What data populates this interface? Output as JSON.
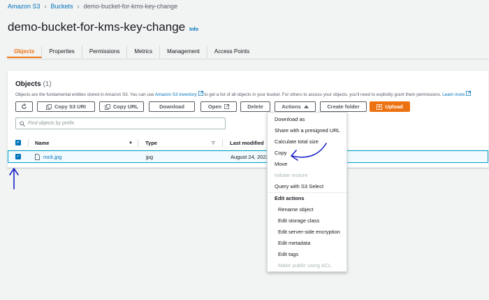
{
  "breadcrumb": {
    "root": "Amazon S3",
    "buckets": "Buckets",
    "current": "demo-bucket-for-kms-key-change"
  },
  "page": {
    "title": "demo-bucket-for-kms-key-change",
    "info": "Info"
  },
  "tabs": [
    "Objects",
    "Properties",
    "Permissions",
    "Metrics",
    "Management",
    "Access Points"
  ],
  "objects": {
    "title": "Objects",
    "count": "(1)",
    "description_pre": "Objects are the fundamental entities stored in Amazon S3. You can use ",
    "inventory_link": "Amazon S3 inventory",
    "description_post": " to get a list of all objects in your bucket. For others to access your objects, you'll need to explicitly grant them permissions. ",
    "learn_more": "Learn more"
  },
  "toolbar": {
    "copy_s3_uri": "Copy S3 URI",
    "copy_url": "Copy URL",
    "download": "Download",
    "open": "Open",
    "delete": "Delete",
    "actions": "Actions",
    "create_folder": "Create folder",
    "upload": "Upload"
  },
  "search": {
    "placeholder": "Find objects by prefix"
  },
  "table": {
    "columns": [
      "Name",
      "Type",
      "Last modified"
    ],
    "rows": [
      {
        "name": "rock.jpg",
        "type": "jpg",
        "last_modified": "August 24, 2022"
      }
    ]
  },
  "actions_menu": {
    "items": [
      {
        "label": "Download as",
        "disabled": false
      },
      {
        "label": "Share with a presigned URL",
        "disabled": false
      },
      {
        "label": "Calculate total size",
        "disabled": false
      },
      {
        "label": "Copy",
        "disabled": false
      },
      {
        "label": "Move",
        "disabled": false
      },
      {
        "label": "Initiate restore",
        "disabled": true
      },
      {
        "label": "Query with S3 Select",
        "disabled": false
      }
    ],
    "group_label": "Edit actions",
    "edit_items": [
      {
        "label": "Rename object",
        "disabled": false
      },
      {
        "label": "Edit storage class",
        "disabled": false
      },
      {
        "label": "Edit server-side encryption",
        "disabled": false
      },
      {
        "label": "Edit metadata",
        "disabled": false
      },
      {
        "label": "Edit tags",
        "disabled": false
      },
      {
        "label": "Make public using ACL",
        "disabled": true
      }
    ]
  },
  "colors": {
    "accent": "#ec7211",
    "link": "#0073bb",
    "selected_row": "#f1faff",
    "annotation": "#1a22c8"
  },
  "icons": [
    "refresh-icon",
    "copy-icon",
    "external-link-icon",
    "caret-up-icon",
    "upload-icon",
    "search-icon",
    "file-icon",
    "sort-icon",
    "filter-icon",
    "checkmark-icon"
  ]
}
